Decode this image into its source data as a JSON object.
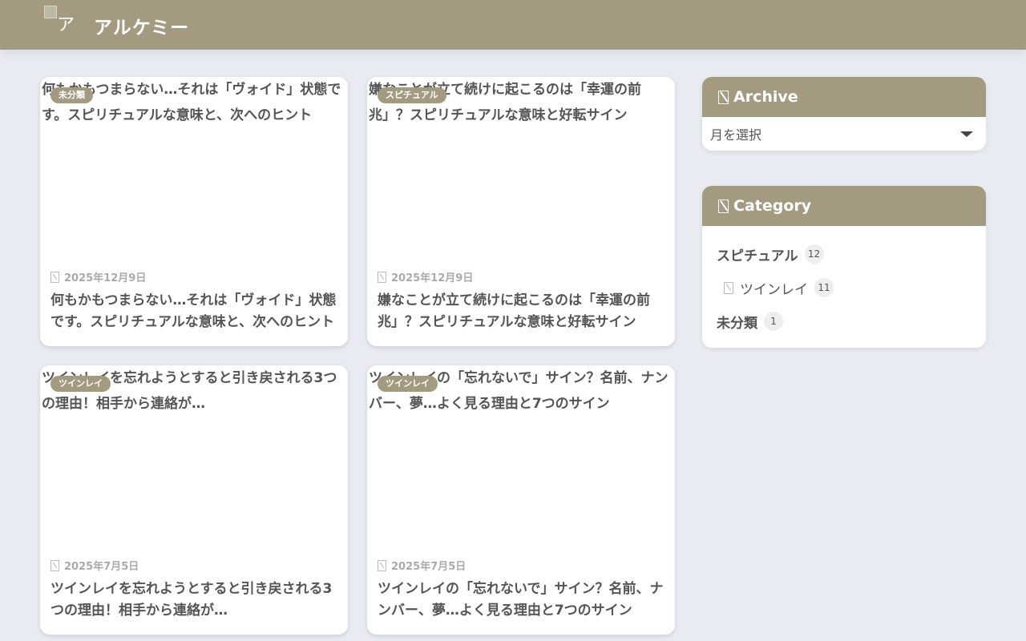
{
  "header": {
    "logo_alt": "ア",
    "site_title": "アルケミー"
  },
  "posts": [
    {
      "image_alt": "何もかもつまらない…それは「ヴォイド」状態です。スピリチュアルな意味と、次へのヒント",
      "category": "未分類",
      "date": "2025年12月9日",
      "title": "何もかもつまらない…それは「ヴォイド」状態です。スピリチュアルな意味と、次へのヒント"
    },
    {
      "image_alt": "嫌なことが立て続けに起こるのは「幸運の前兆」？スピリチュアルな意味と好転サイン",
      "category": "スピチュアル",
      "date": "2025年12月9日",
      "title": "嫌なことが立て続けに起こるのは「幸運の前兆」？スピリチュアルな意味と好転サイン"
    },
    {
      "image_alt": "ツインレイを忘れようとすると引き戻される3つの理由！相手から連絡が…",
      "category": "ツインレイ",
      "date": "2025年7月5日",
      "title": "ツインレイを忘れようとすると引き戻される3つの理由！相手から連絡が…"
    },
    {
      "image_alt": "ツインレイの「忘れないで」サイン？名前、ナンバー、夢…よく見る理由と7つのサイン",
      "category": "ツインレイ",
      "date": "2025年7月5日",
      "title": "ツインレイの「忘れないで」サイン？名前、ナンバー、夢…よく見る理由と7つのサイン"
    }
  ],
  "sidebar": {
    "archive": {
      "title": "Archive",
      "select_value": "月を選択"
    },
    "category": {
      "title": "Category",
      "items": [
        {
          "label": "スピチュアル",
          "count": "12"
        },
        {
          "label": "ツインレイ",
          "count": "11"
        },
        {
          "label": "未分類",
          "count": "1"
        }
      ]
    }
  },
  "colors": {
    "accent": "#a39a80",
    "background": "#e8ebf1"
  }
}
